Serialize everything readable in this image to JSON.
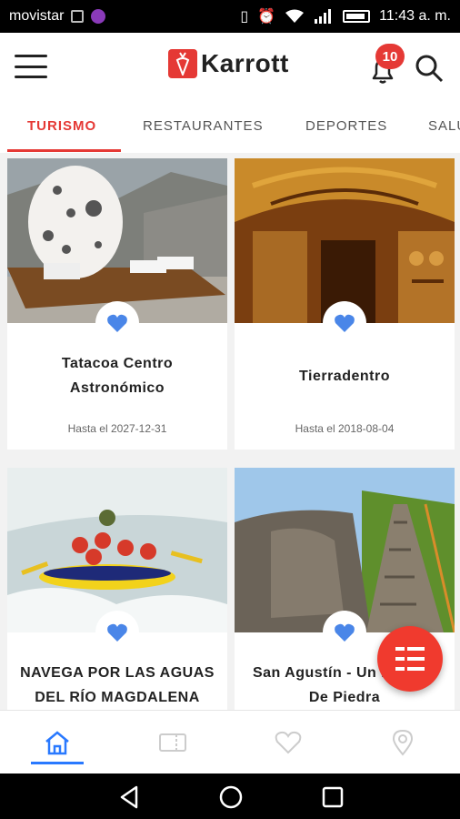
{
  "status_bar": {
    "carrier": "movistar",
    "time": "11:43 a. m."
  },
  "header": {
    "logo_text": "Karrott",
    "notification_count": "10"
  },
  "tabs": [
    {
      "label": "TURISMO",
      "active": true
    },
    {
      "label": "RESTAURANTES",
      "active": false
    },
    {
      "label": "DEPORTES",
      "active": false
    },
    {
      "label": "SALUD",
      "active": false
    }
  ],
  "cards": [
    {
      "title": "Tatacoa Centro Astronómico",
      "date": "Hasta el 2027-12-31"
    },
    {
      "title": "Tierradentro",
      "date": "Hasta el 2018-08-04"
    },
    {
      "title": "NAVEGA POR LAS AGUAS DEL RÍO MAGDALENA",
      "date": ""
    },
    {
      "title": "San Agustín - Un Enigma De Piedra",
      "date": ""
    }
  ],
  "colors": {
    "accent": "#e53935",
    "favorite": "#4a86e8",
    "nav_active": "#2979ff"
  },
  "bottom_nav": [
    {
      "icon": "home-icon",
      "active": true
    },
    {
      "icon": "ticket-icon",
      "active": false
    },
    {
      "icon": "heart-icon",
      "active": false
    },
    {
      "icon": "location-pin-icon",
      "active": false
    }
  ]
}
